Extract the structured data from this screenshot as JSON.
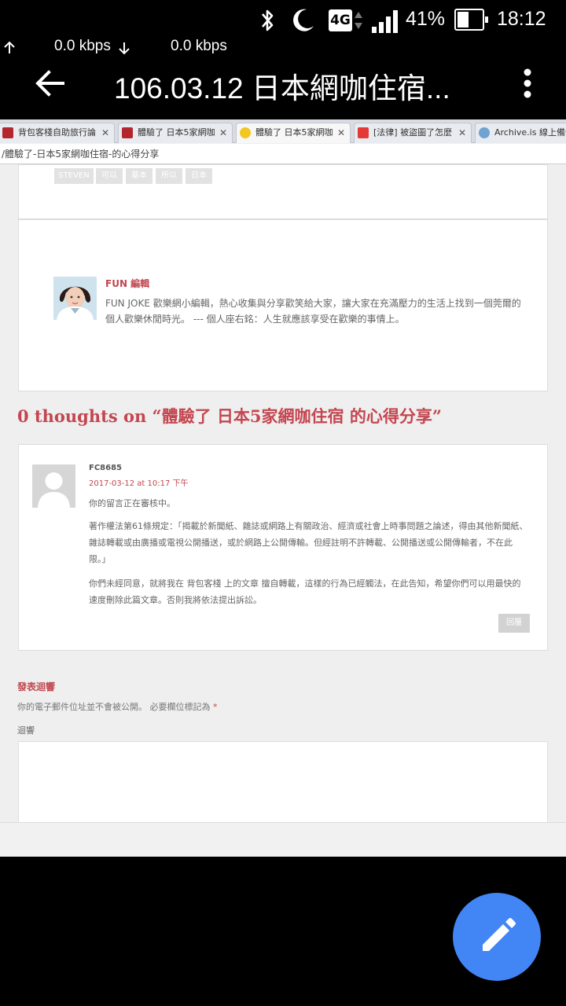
{
  "status_bar": {
    "network": "4G",
    "battery_level": "41%",
    "time": "18:12",
    "icons": [
      "bluetooth-icon",
      "do-not-disturb-moon-icon",
      "4g-icon",
      "signal-icon",
      "battery-icon"
    ]
  },
  "speed": {
    "upload": "0.0 kbps",
    "download": "0.0 kbps"
  },
  "app_bar": {
    "title": "106.03.12 日本網咖住宿...",
    "back_icon": "arrow-left-icon",
    "menu_icon": "more-vert-icon"
  },
  "browser": {
    "tabs": [
      {
        "label": "背包客棧自助旅行論",
        "favicon_color": "#b3262d"
      },
      {
        "label": "體驗了 日本5家網咖",
        "favicon_color": "#b3262d"
      },
      {
        "label": "體驗了 日本5家網咖",
        "favicon_color": "#f3c623"
      },
      {
        "label": "[法律] 被盜圖了怎麼",
        "favicon_color": "#e53935"
      },
      {
        "label": "Archive.is 線上備份",
        "favicon_color": "#6fa3d2"
      }
    ],
    "url": "/體驗了-日本5家網咖住宿-的心得分享"
  },
  "post": {
    "tags": [
      "STEVEN",
      "可以",
      "基本",
      "所以",
      "日本"
    ]
  },
  "author": {
    "name": "FUN 編輯",
    "bio": "FUN JOKE 歡樂網小編輯，熱心收集與分享歡笑給大家，讓大家在充滿壓力的生活上找到一個莞爾的個人歡樂休閒時光。 --- 個人座右銘：人生就應該享受在歡樂的事情上。"
  },
  "comments": {
    "heading": "0 thoughts on “體驗了 日本5家網咖住宿 的心得分享”",
    "items": [
      {
        "author": "FC8685",
        "date": "2017-03-12 at 10:17 下午",
        "moderation": "你的留言正在審核中。",
        "paragraph1": "著作權法第61條規定：「揭載於新聞紙、雜誌或網路上有關政治、經濟或社會上時事問題之論述，得由其他新聞紙、雜誌轉載或由廣播或電視公開播送，或於網路上公開傳輸。但經註明不許轉載、公開播送或公開傳輸者，不在此限。」",
        "paragraph2": "你們未經同意，就將我在 背包客棧 上的文章 擅自轉載，這樣的行為已經觸法，在此告知，希望你們可以用最快的速度刪除此篇文章。否則我將依法提出訴訟。",
        "reply_label": "回覆"
      }
    ]
  },
  "reply_form": {
    "heading": "發表迴響",
    "note": "你的電子郵件位址並不會被公開。 必要欄位標記為",
    "required_mark": "*",
    "comment_label": "迴響"
  },
  "fab": {
    "icon": "pencil-edit-icon",
    "color": "#4285f4"
  }
}
